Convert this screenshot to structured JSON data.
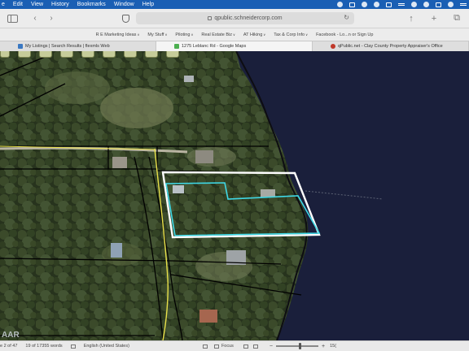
{
  "menubar": {
    "items": [
      "e",
      "Edit",
      "View",
      "History",
      "Bookmarks",
      "Window",
      "Help"
    ]
  },
  "toolbar": {
    "url": "qpublic.schneidercorp.com"
  },
  "bookmarks": [
    {
      "label": "R E Marketing Ideas"
    },
    {
      "label": "My Stuff"
    },
    {
      "label": "Piloting"
    },
    {
      "label": "Real Estate Biz"
    },
    {
      "label": "AT Hiking"
    },
    {
      "label": "Tax & Corp Info"
    },
    {
      "label": "Facebook - Lo...n or Sign Up"
    }
  ],
  "tabs": [
    {
      "label": "My Listings | Search Results | flexmls Web",
      "active": false,
      "color": "#3a78c2"
    },
    {
      "label": "1275 Leblanc Rd - Google Maps",
      "active": true,
      "color": "#4caf50"
    },
    {
      "label": "qPublic.net - Clay County Property Appraiser's Office",
      "active": false,
      "color": "#c0392b"
    }
  ],
  "map": {
    "watermark": "AAR",
    "parcel_highlight_color": "#ffffff",
    "lot_outline_color": "#3fd8e6",
    "road_line_color": "#e8e04a",
    "water_color": "#1a1f3b"
  },
  "statusbar": {
    "page": "e 2 of 47",
    "words": "19 of 17355 words",
    "language": "English (United States)",
    "focus": "Focus",
    "zoom": "15("
  }
}
